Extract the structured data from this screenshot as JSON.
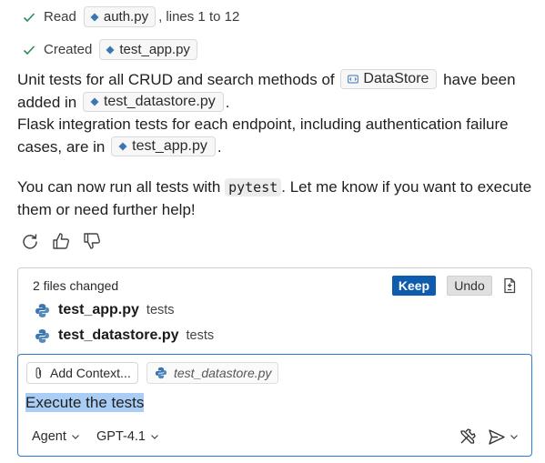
{
  "steps": [
    {
      "verb": "Read",
      "file": "auth.py",
      "tail": ", lines 1 to 12"
    },
    {
      "verb": "Created",
      "file": "test_app.py",
      "tail": ""
    }
  ],
  "message": {
    "p1": {
      "t1": "Unit tests for all CRUD and search methods of",
      "class_chip": "DataStore",
      "t2": "have been added in",
      "file_chip": "test_datastore.py",
      "t3": "."
    },
    "p2": {
      "t1": "Flask integration tests for each endpoint, including authentication failure cases, are in",
      "file_chip": "test_app.py",
      "t2": "."
    },
    "p3": {
      "t1": "You can now run all tests with",
      "code": "pytest",
      "t2": ". Let me know if you want to execute them or need further help!"
    }
  },
  "feedback_icons": [
    "retry-icon",
    "thumbs-up-icon",
    "thumbs-down-icon"
  ],
  "changes": {
    "count_label": "2 files changed",
    "keep_label": "Keep",
    "undo_label": "Undo",
    "files": [
      {
        "name": "test_app.py",
        "dir": "tests"
      },
      {
        "name": "test_datastore.py",
        "dir": "tests"
      }
    ]
  },
  "input": {
    "add_context_label": "Add Context...",
    "context_file": "test_datastore.py",
    "prompt_text": "Execute the tests",
    "mode_label": "Agent",
    "model_label": "GPT-4.1"
  },
  "colors": {
    "accent": "#0e5cad",
    "check": "#2e8b57",
    "selection": "#a9cdf4",
    "focus_border": "#2f7bd6",
    "python_blue": "#3a76b0",
    "python_yellow": "#f2c94c"
  }
}
